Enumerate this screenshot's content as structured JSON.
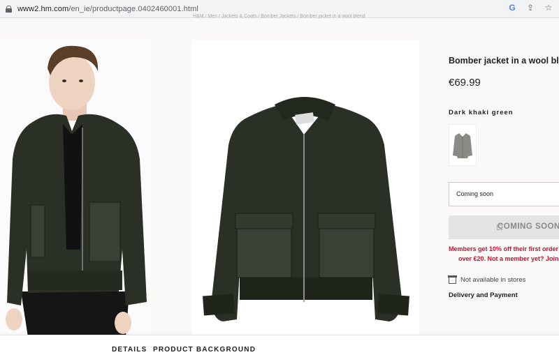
{
  "browser": {
    "url_host": "www2.hm.com",
    "url_path": "/en_ie/productpage.0402460001.html"
  },
  "breadcrumb": "H&M / Men / Jackets & Coats / Bomber Jackets / Bomber jacket in a wool blend",
  "product": {
    "title": "Bomber jacket in a wool blend",
    "price": "€69.99",
    "color": "Dark khaki green",
    "size_select": "Coming soon",
    "button_label": "COMING SOON",
    "members_line1": "Members get 10% off their first order",
    "members_line2": "over €20. Not a member yet? Join",
    "store_availability": "Not available in stores",
    "delivery": "Delivery and Payment"
  },
  "tabs": [
    {
      "label": "DETAILS"
    },
    {
      "label": "PRODUCT BACKGROUND"
    }
  ],
  "colors": {
    "jacket": "#2b3026",
    "accent_red": "#c8102e"
  }
}
